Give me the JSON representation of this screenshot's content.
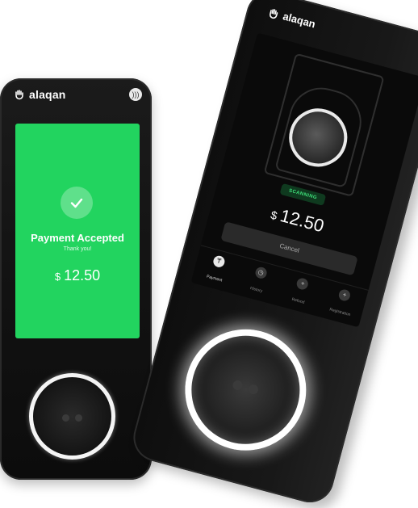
{
  "left_device": {
    "brand": "alaqan",
    "screen": {
      "title": "Payment Accepted",
      "subtitle": "Thank you!",
      "currency": "$",
      "amount": "12.50",
      "background_color": "#22d45f"
    }
  },
  "right_device": {
    "brand": "alaqan",
    "screen": {
      "status": "SCANNING",
      "currency": "$",
      "amount": "12.50",
      "cancel_label": "Cancel",
      "nav": [
        {
          "label": "Payment",
          "icon": "wallet-icon",
          "active": true
        },
        {
          "label": "History",
          "icon": "clock-icon",
          "active": false
        },
        {
          "label": "Refund",
          "icon": "plus-icon",
          "active": false
        },
        {
          "label": "Registration",
          "icon": "plus-icon",
          "active": false
        }
      ]
    }
  },
  "colors": {
    "success_green": "#22d45f",
    "device_body": "#141414",
    "scan_badge_text": "#3ee07a"
  }
}
